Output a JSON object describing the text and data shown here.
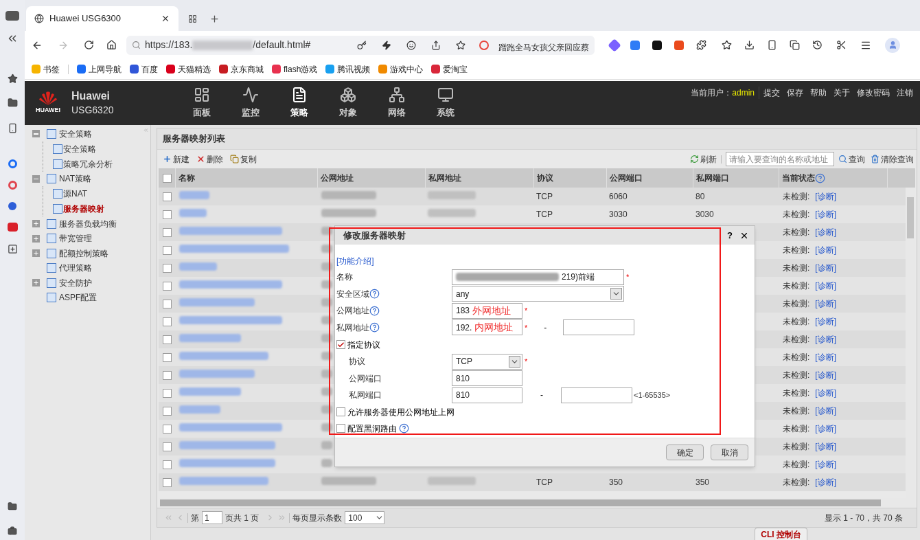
{
  "browser": {
    "tabs": [
      {
        "title": "Huawei USG6300",
        "selected": true
      }
    ],
    "url": {
      "prefix": "https://183.",
      "suffix": "/default.html#"
    },
    "news": "蹭跑全马女孩父亲回应蔡",
    "bookmarks": [
      "书签",
      "上网导航",
      "百度",
      "天猫精选",
      "京东商城",
      "flash游戏",
      "腾讯视频",
      "游戏中心",
      "爱淘宝"
    ]
  },
  "app": {
    "logo_text": "HUAWEI",
    "brand": "Huawei",
    "model": "USG6320",
    "nav": [
      {
        "label": "面板",
        "selected": false
      },
      {
        "label": "监控",
        "selected": false
      },
      {
        "label": "策略",
        "selected": true
      },
      {
        "label": "对象",
        "selected": false
      },
      {
        "label": "网络",
        "selected": false
      },
      {
        "label": "系统",
        "selected": false
      }
    ],
    "user_label": "当前用户：",
    "user": "admin",
    "links": [
      "提交",
      "保存",
      "帮助",
      "关于",
      "修改密码",
      "注销"
    ]
  },
  "sidebar": {
    "items": [
      {
        "label": "安全策略",
        "expanded": true,
        "selected": false,
        "children": [
          {
            "label": "安全策略",
            "selected": false
          },
          {
            "label": "策略冗余分析",
            "selected": false
          }
        ]
      },
      {
        "label": "NAT策略",
        "expanded": true,
        "selected": false,
        "children": [
          {
            "label": "源NAT",
            "selected": false
          },
          {
            "label": "服务器映射",
            "selected": true
          }
        ]
      },
      {
        "label": "服务器负载均衡",
        "expanded": false,
        "selected": false
      },
      {
        "label": "带宽管理",
        "expanded": false,
        "selected": false
      },
      {
        "label": "配额控制策略",
        "expanded": false,
        "selected": false
      },
      {
        "label": "代理策略",
        "selected": false
      },
      {
        "label": "安全防护",
        "expanded": false,
        "selected": false
      },
      {
        "label": "ASPF配置",
        "selected": false
      }
    ]
  },
  "panel": {
    "title": "服务器映射列表",
    "actions": [
      "新建",
      "删除",
      "复制"
    ],
    "refresh": "刷新",
    "search": {
      "placeholder": "请输入要查询的名称或地址"
    },
    "query": "查询",
    "clear": "清除查询",
    "table": {
      "select_all": {
        "checked": false
      },
      "columns": [
        "名称",
        "公网地址",
        "私网地址",
        "协议",
        "公网端口",
        "私网端口",
        "当前状态"
      ],
      "rows": [
        {
          "checked": false,
          "protocol": "TCP",
          "public_port": "6060",
          "private_port": "80",
          "status": "未检测:",
          "action": "[诊断]"
        },
        {
          "checked": false,
          "protocol": "TCP",
          "public_port": "3030",
          "private_port": "3030",
          "status": "未检测:",
          "action": "[诊断]"
        },
        {
          "checked": false,
          "status": "未检测:",
          "action": "[诊断]"
        },
        {
          "checked": false,
          "status": "未检测:",
          "action": "[诊断]"
        },
        {
          "checked": false,
          "status": "未检测:",
          "action": "[诊断]"
        },
        {
          "checked": false,
          "status": "未检测:",
          "action": "[诊断]"
        },
        {
          "checked": false,
          "status": "未检测:",
          "action": "[诊断]"
        },
        {
          "checked": false,
          "status": "未检测:",
          "action": "[诊断]"
        },
        {
          "checked": false,
          "status": "未检测:",
          "action": "[诊断]"
        },
        {
          "checked": false,
          "status": "未检测:",
          "action": "[诊断]"
        },
        {
          "checked": false,
          "status": "未检测:",
          "action": "[诊断]"
        },
        {
          "checked": false,
          "status": "未检测:",
          "action": "[诊断]"
        },
        {
          "checked": false,
          "status": "未检测:",
          "action": "[诊断]"
        },
        {
          "checked": false,
          "status": "未检测:",
          "action": "[诊断]"
        },
        {
          "checked": false,
          "status": "未检测:",
          "action": "[诊断]"
        },
        {
          "checked": false,
          "status": "未检测:",
          "action": "[诊断]"
        },
        {
          "checked": false,
          "protocol": "TCP",
          "public_port": "350",
          "private_port": "350",
          "status": "未检测:",
          "action": "[诊断]"
        }
      ]
    },
    "pager": {
      "page_label": "第",
      "page": "1",
      "page_total": "页共 1 页",
      "per_page_label": "每页显示条数",
      "per_page": "100",
      "summary": "显示 1 - 70，共 70 条"
    },
    "cli": "CLI 控制台"
  },
  "dialog": {
    "title": "修改服务器映射",
    "help": "?",
    "intro": "[功能介绍]",
    "name": {
      "label": "名称",
      "value": "219)前端",
      "required": "*"
    },
    "zone": {
      "label": "安全区域",
      "value": "any"
    },
    "public_address": {
      "label": "公网地址",
      "value": "183",
      "annotation": "外网地址",
      "required": "*"
    },
    "private_address": {
      "label": "私网地址",
      "value": "192.",
      "annotation": "内网地址",
      "required": "*",
      "range_sep": "-"
    },
    "specify_protocol": {
      "label": "指定协议",
      "checked": true
    },
    "protocol": {
      "label": "协议",
      "value": "TCP",
      "required": "*"
    },
    "public_port": {
      "label": "公网端口",
      "value": "810"
    },
    "private_port": {
      "label": "私网端口",
      "value": "810",
      "range_sep": "-",
      "hint": "<1-65535>"
    },
    "allow_public": {
      "label": "允许服务器使用公网地址上网",
      "checked": false
    },
    "blackhole": {
      "label": "配置黑洞路由",
      "checked": false
    },
    "buttons": [
      "确定",
      "取消"
    ]
  }
}
